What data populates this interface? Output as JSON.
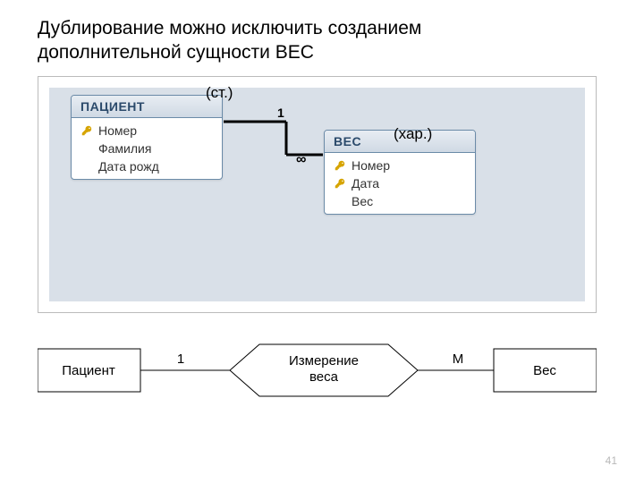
{
  "title_line1": "Дублирование можно исключить созданием",
  "title_line2": "дополнительной сущности ВЕС",
  "annotations": {
    "st": "(ст.)",
    "har": "(хар.)"
  },
  "tables": {
    "patient": {
      "header": "ПАЦИЕНТ",
      "fields": [
        {
          "key": true,
          "label": "Номер"
        },
        {
          "key": false,
          "label": "Фамилия"
        },
        {
          "key": false,
          "label": "Дата рожд"
        }
      ]
    },
    "weight": {
      "header": "ВЕС",
      "fields": [
        {
          "key": true,
          "label": "Номер"
        },
        {
          "key": true,
          "label": "Дата"
        },
        {
          "key": false,
          "label": "Вес"
        }
      ]
    }
  },
  "relation": {
    "left_card": "1",
    "right_card": "∞"
  },
  "erd": {
    "left_entity": "Пациент",
    "relationship": "Измерение\nвеса",
    "right_entity": "Вес",
    "left_card": "1",
    "right_card": "M"
  },
  "page_number": "41"
}
